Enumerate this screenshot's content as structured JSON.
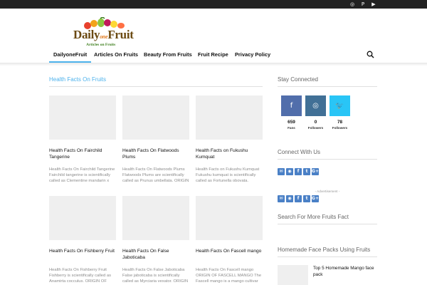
{
  "topbar": {
    "icons": [
      "instagram-icon",
      "pinterest-icon",
      "youtube-icon"
    ]
  },
  "logo": {
    "word_left": "Daily",
    "word_mid": "one",
    "word_right": "Fruit",
    "tagline": "Articles on Fruits"
  },
  "nav": {
    "items": [
      "DailyoneFruit",
      "Articles On Fruits",
      "Beauty From Fruits",
      "Fruit Recipe",
      "Privacy Policy"
    ],
    "accent": "#4db2ec"
  },
  "main": {
    "block_title": "Health Facts On Fruits",
    "posts": [
      {
        "title": "Health Facts On Fairchild Tangerine",
        "excerpt": "Health Facts On Fairchild Tangerine Fairchild tangerine is scientifically called as Clementine mandarin x Orlando tangelo..."
      },
      {
        "title": "Health Facts On Flatwoods Plums",
        "excerpt": "Health Facts On Flatwoods Plums Flatwoods Plums are scientifically called as Prunus umbellata. ORIGIN OF FLATWOODS..."
      },
      {
        "title": "Health Facts on Fukushu Kumquat",
        "excerpt": "Health Facts on Fukushu Kumquat Fukushu kumquat is scientifically called as Fortunella obovata. ORIGIN OF FUKUSHU..."
      },
      {
        "title": "Health Facts On Fishberry Fruit",
        "excerpt": "Health Facts On Fishberry Fruit Fishberry is scientifically called as Anamirta cocculus. ORIGIN OF FISHBERRY Anamirta cocculus..."
      },
      {
        "title": "Health Facts On False Jaboticaba",
        "excerpt": "Health Facts On False Jaboticaba False jaboticaba is scientifically called as Myrciaria vexator. ORIGIN OF..."
      },
      {
        "title": "Health Facts On Fascell mango",
        "excerpt": "Health Facts On Fascell mango ORIGIN OF FASCELL MANGO The Fascell mango is a mango cultivar that originated in..."
      }
    ]
  },
  "sidebar": {
    "stay_connected": "Stay Connected",
    "social": [
      {
        "icon": "facebook-icon",
        "glyph": "f",
        "count": "659",
        "label": "Fans",
        "color": "#516eab"
      },
      {
        "icon": "instagram-icon",
        "glyph": "◎",
        "count": "0",
        "label": "Followers",
        "color": "#417096"
      },
      {
        "icon": "twitter-icon",
        "glyph": "🐦",
        "count": "78",
        "label": "Followers",
        "color": "#29c5f6"
      }
    ],
    "connect_with_us": "Connect With Us",
    "connect_icons": [
      {
        "icon": "email-icon",
        "glyph": "✉"
      },
      {
        "icon": "rss-icon",
        "glyph": "◉"
      },
      {
        "icon": "facebook-icon",
        "glyph": "f"
      },
      {
        "icon": "twitter-icon",
        "glyph": "t"
      },
      {
        "icon": "googleplus-icon",
        "glyph": "G+"
      }
    ],
    "advertisement": "- Advertisement -",
    "search_title": "Search For More Fruits Fact",
    "face_packs_title": "Homemade Face Packs Using Fruits",
    "face_post": "Top 5 Homemade Mango face pack"
  }
}
